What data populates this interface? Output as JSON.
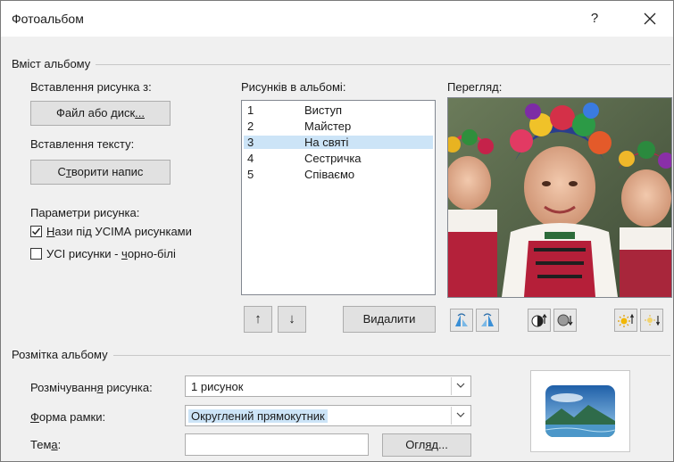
{
  "dialog": {
    "title": "Фотоальбом",
    "help_glyph": "?",
    "close_glyph": "✕"
  },
  "content_group": {
    "label": "Вміст альбому",
    "insert_picture_label": "Вставлення рисунка з:",
    "file_button_pre": "Файл або диск",
    "file_button_u": "...",
    "insert_text_label": "Вставлення тексту:",
    "textbox_button_pre": "С",
    "textbox_button_u": "т",
    "textbox_button_post": "ворити напис",
    "picture_options_label": "Параметри рисунка:",
    "captions_checkbox": {
      "pre": "",
      "u": "Н",
      "post": "ази під УСІМА рисунками",
      "checked": true
    },
    "bw_checkbox": {
      "pre": "УСІ рисунки - ",
      "u": "ч",
      "post": "орно-білі",
      "checked": false
    }
  },
  "pictures": {
    "label": "Рисунків в альбомі:",
    "items": [
      {
        "num": "1",
        "name": "Виступ",
        "selected": false
      },
      {
        "num": "2",
        "name": "Майстер",
        "selected": false
      },
      {
        "num": "3",
        "name": "На святі",
        "selected": true
      },
      {
        "num": "4",
        "name": "Сестричка",
        "selected": false
      },
      {
        "num": "5",
        "name": "Співаємо",
        "selected": false
      }
    ],
    "move_up_glyph": "↑",
    "move_down_glyph": "↓",
    "remove_button_pre": "Ви",
    "remove_button_u": "д",
    "remove_button_post": "алити"
  },
  "preview": {
    "label": "Перегляд:"
  },
  "layout_group": {
    "label": "Розмітка альбому",
    "picture_layout_label_pre": "Розмічуванн",
    "picture_layout_label_u": "я",
    "picture_layout_label_post": " рисунка:",
    "picture_layout_value": "1 рисунок",
    "frame_shape_label_pre": "",
    "frame_shape_label_u": "Ф",
    "frame_shape_label_post": "орма рамки:",
    "frame_shape_value": "Округлений прямокутник",
    "theme_label_pre": "Тем",
    "theme_label_u": "а",
    "theme_label_post": ":",
    "theme_value": "",
    "browse_button_pre": "Огл",
    "browse_button_u": "я",
    "browse_button_post": "д..."
  },
  "colors": {
    "selection": "#cce4f7",
    "dialog_bg": "#f0f0f0"
  }
}
